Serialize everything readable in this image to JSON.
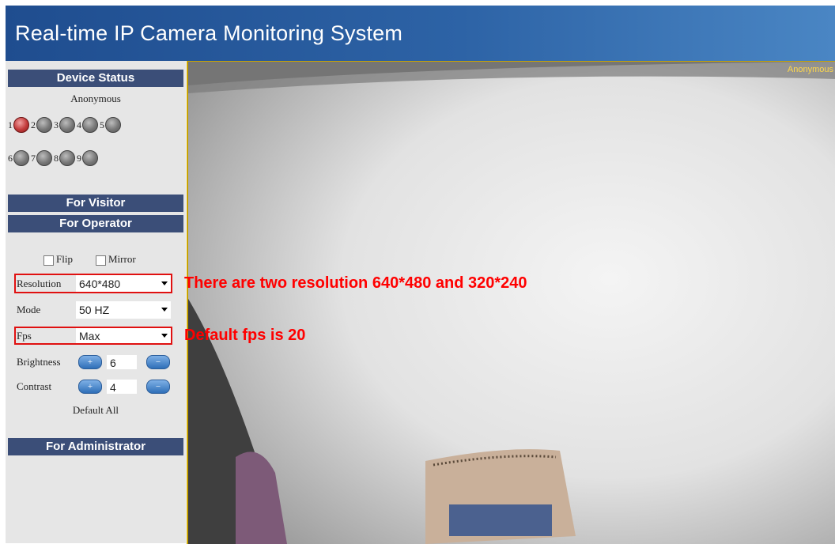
{
  "app": {
    "title": "Real-time IP Camera Monitoring System"
  },
  "sidebar": {
    "device_status": {
      "heading": "Device Status",
      "user": "Anonymous",
      "cameras": [
        {
          "num": "1",
          "active": true
        },
        {
          "num": "2",
          "active": false
        },
        {
          "num": "3",
          "active": false
        },
        {
          "num": "4",
          "active": false
        },
        {
          "num": "5",
          "active": false
        },
        {
          "num": "6",
          "active": false
        },
        {
          "num": "7",
          "active": false
        },
        {
          "num": "8",
          "active": false
        },
        {
          "num": "9",
          "active": false
        }
      ]
    },
    "for_visitor": "For Visitor",
    "for_operator": "For Operator",
    "flip_label": "Flip",
    "mirror_label": "Mirror",
    "resolution": {
      "label": "Resolution",
      "value": "640*480"
    },
    "mode": {
      "label": "Mode",
      "value": "50 HZ"
    },
    "fps": {
      "label": "Fps",
      "value": "Max"
    },
    "brightness": {
      "label": "Brightness",
      "value": "6"
    },
    "contrast": {
      "label": "Contrast",
      "value": "4"
    },
    "default_all": "Default All",
    "for_administrator": "For Administrator"
  },
  "video": {
    "overlay_user": "Anonymous"
  },
  "annotations": {
    "resolution_note": "There are two resolution 640*480 and 320*240",
    "fps_note": "Default fps is 20"
  },
  "colors": {
    "header": "#2d63a6",
    "section": "#3b4e78",
    "annotation": "#ff0000",
    "active_led": "#c23a3a"
  },
  "icons": {
    "led": "camera-status-led-icon",
    "plus": "plus-icon",
    "minus": "minus-icon",
    "dropdown": "chevron-down-icon"
  }
}
